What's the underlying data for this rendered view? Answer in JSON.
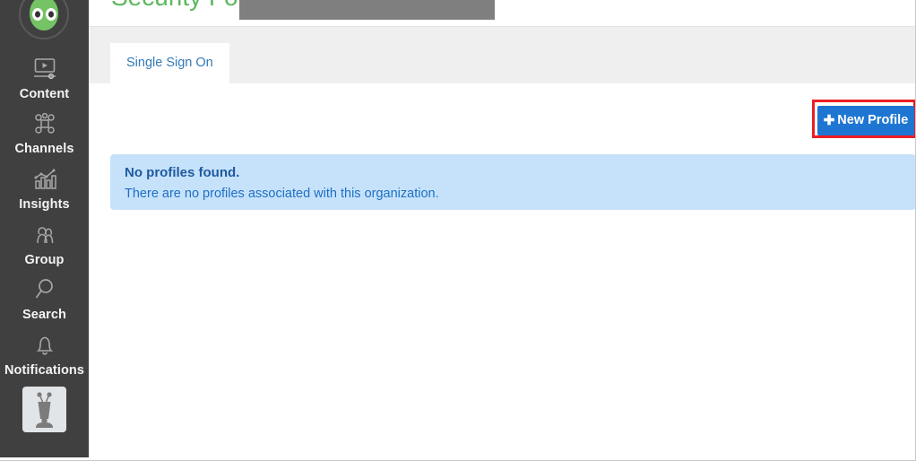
{
  "sidebar": {
    "brand": {
      "icon": "alien-avatar-icon",
      "color": "#74c365"
    },
    "items": [
      {
        "label": "Content",
        "icon": "media-player-icon"
      },
      {
        "label": "Channels",
        "icon": "network-nodes-icon"
      },
      {
        "label": "Insights",
        "icon": "bar-chart-trend-icon"
      },
      {
        "label": "Group",
        "icon": "people-group-icon"
      },
      {
        "label": "Search",
        "icon": "magnifier-icon"
      },
      {
        "label": "Notifications",
        "icon": "bell-icon"
      }
    ],
    "user_avatar": {
      "icon": "robot-avatar-icon"
    },
    "background_color": "#404040"
  },
  "header": {
    "title": "Security For:",
    "title_color": "#5cb85c",
    "org_name_redacted": "",
    "redaction_color": "#7f7f7f"
  },
  "tabs": [
    {
      "label": "Single Sign On",
      "active": true
    }
  ],
  "toolbar": {
    "new_profile_label": "New Profile",
    "new_profile_icon": "plus-icon",
    "plus_glyph": "✚",
    "button_color": "#1f76d2",
    "highlight_color": "#ee1c24"
  },
  "alert": {
    "title": "No profiles found.",
    "message": "There are no profiles associated with this organization.",
    "background_color": "#c6e2fb",
    "text_color": "#1f5a9e"
  }
}
